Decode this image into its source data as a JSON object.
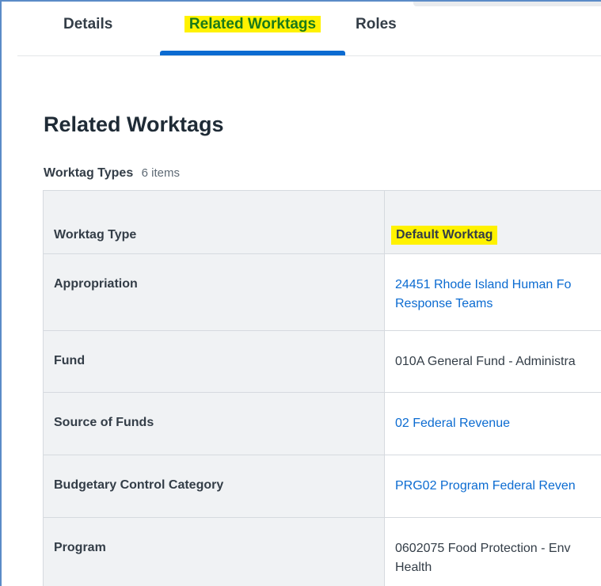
{
  "tabs": [
    {
      "label": "Details"
    },
    {
      "label": "Related Worktags"
    },
    {
      "label": "Roles"
    }
  ],
  "page_title": "Related Worktags",
  "section": {
    "name": "Worktag Types",
    "count": "6 items"
  },
  "table": {
    "headers": {
      "type": "Worktag Type",
      "default": "Default Worktag"
    },
    "rows": [
      {
        "type": "Appropriation",
        "value_lines": [
          "24451 Rhode Island Human Fo",
          "Response Teams"
        ],
        "is_link": true
      },
      {
        "type": "Fund",
        "value_lines": [
          "010A General Fund - Administra"
        ],
        "is_link": false
      },
      {
        "type": "Source of Funds",
        "value_lines": [
          "02 Federal Revenue"
        ],
        "is_link": true
      },
      {
        "type": "Budgetary Control Category",
        "value_lines": [
          "PRG02 Program Federal Reven"
        ],
        "is_link": true
      },
      {
        "type": "Program",
        "value_lines": [
          "0602075 Food Protection - Env",
          "Health"
        ],
        "is_link": false
      }
    ]
  },
  "colors": {
    "accent": "#0b6bd1",
    "highlight": "#fff200",
    "frame_border": "#5b8bc7"
  }
}
